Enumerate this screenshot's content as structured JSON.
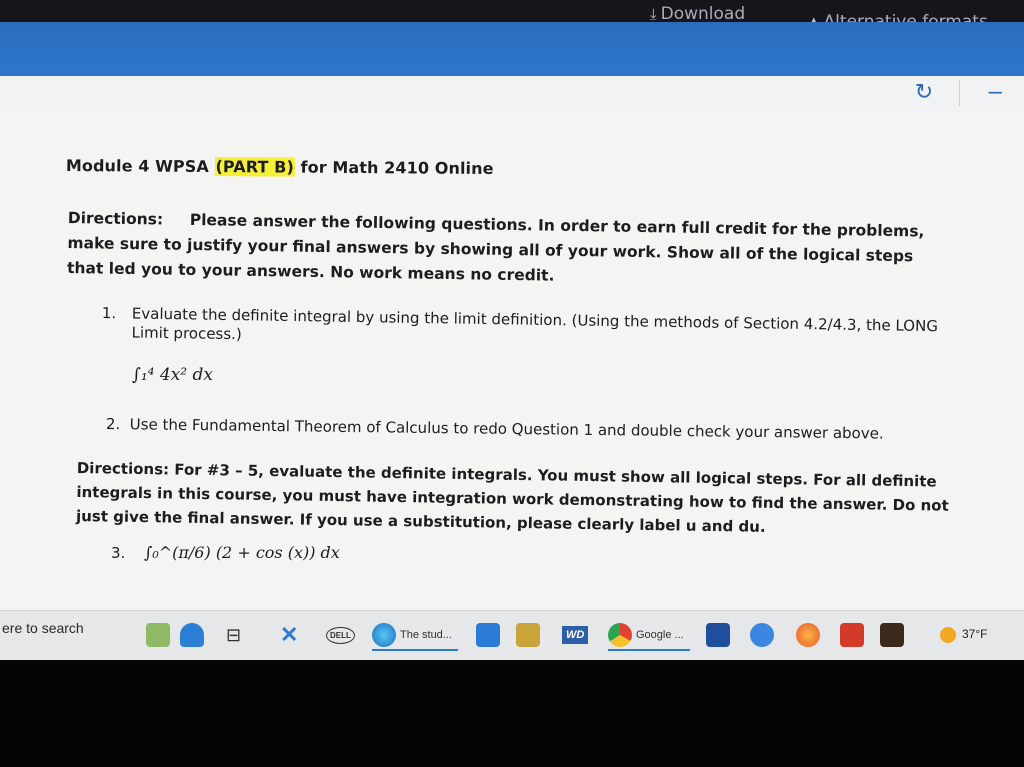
{
  "topbar": {
    "download_label": "Download",
    "alternative_formats_label": "Alternative formats"
  },
  "document": {
    "title_prefix": "Module 4 WPSA ",
    "title_highlight": "(PART B)",
    "title_suffix": " for Math 2410 Online",
    "directions1_label": "Directions:",
    "directions1_text": "Please answer the following questions. In order to earn full credit for the problems, make sure to justify your final answers by showing all of your work. Show all of the logical steps that led you to your answers. No work means no credit.",
    "q1_number": "1.",
    "q1_text": "Evaluate the definite integral by using the limit definition. (Using the methods of Section 4.2/4.3, the LONG Limit process.)",
    "q1_math": "∫₁⁴ 4x² dx",
    "q2_number": "2.",
    "q2_text": "Use the Fundamental Theorem of Calculus to redo Question 1 and double check your answer above.",
    "directions2_text": "Directions: For #3 – 5, evaluate the definite integrals. You must show all logical steps. For all definite integrals in this course, you must have integration work demonstrating how to find the answer. Do not just give the final answer. If you use a substitution, please clearly label u and du.",
    "q3_number": "3.",
    "q3_math": "∫₀^(π/6) (2 + cos (x)) dx"
  },
  "taskbar": {
    "search_text": "ere to search",
    "app_the_stud": "The stud...",
    "app_google": "Google ...",
    "wd_label": "WD",
    "dell_label": "DELL",
    "weather_temp": "37°F"
  },
  "colors": {
    "header_blue": "#2f78cc",
    "highlight_yellow": "#f6ef38"
  }
}
